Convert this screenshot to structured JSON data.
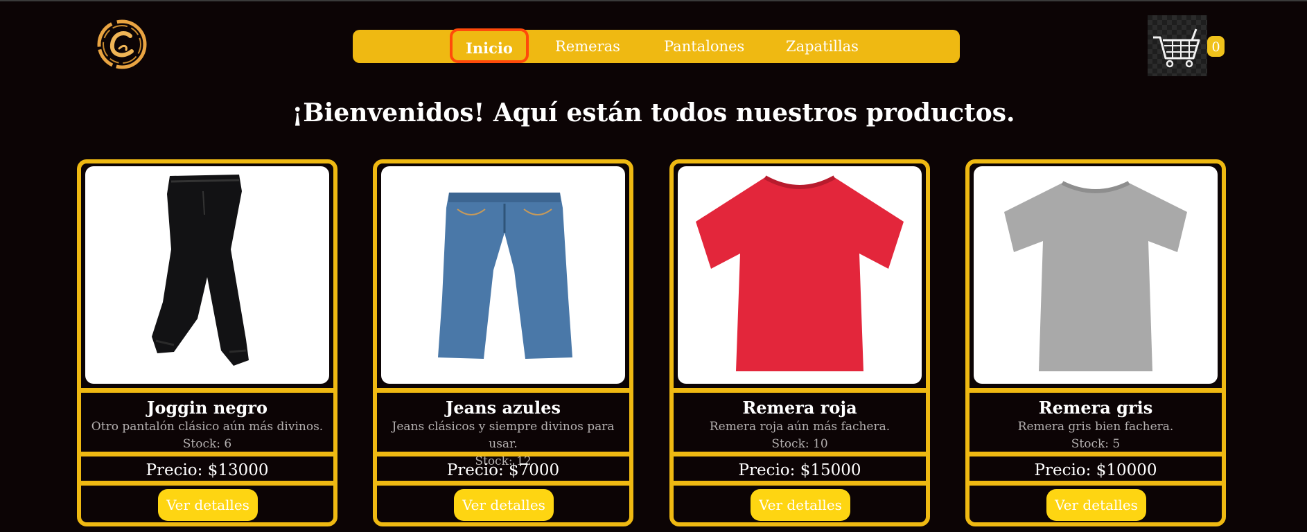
{
  "header": {
    "nav": [
      {
        "label": "Inicio",
        "active": true
      },
      {
        "label": "Remeras",
        "active": false
      },
      {
        "label": "Pantalones",
        "active": false
      },
      {
        "label": "Zapatillas",
        "active": false
      }
    ],
    "cart_count": "0"
  },
  "main": {
    "heading": "¡Bienvenidos! Aquí están todos nuestros productos.",
    "products": [
      {
        "name": "Joggin negro",
        "description": "Otro pantalón clásico aún más divinos.",
        "stock": "Stock: 6",
        "price": "Precio: $13000",
        "button": "Ver detalles",
        "image": "black-jogger-pants"
      },
      {
        "name": "Jeans azules",
        "description": "Jeans clásicos y siempre divinos para usar.",
        "stock": "Stock: 12",
        "price": "Precio: $7000",
        "button": "Ver detalles",
        "image": "blue-jeans"
      },
      {
        "name": "Remera roja",
        "description": "Remera roja aún más fachera.",
        "stock": "Stock: 10",
        "price": "Precio: $15000",
        "button": "Ver detalles",
        "image": "red-tshirt"
      },
      {
        "name": "Remera gris",
        "description": "Remera gris bien fachera.",
        "stock": "Stock: 5",
        "price": "Precio: $10000",
        "button": "Ver detalles",
        "image": "gray-tshirt"
      }
    ]
  },
  "colors": {
    "background": "#0c0405",
    "accent": "#efb912",
    "button": "#fed512",
    "active_outline": "#ff4a0a"
  }
}
